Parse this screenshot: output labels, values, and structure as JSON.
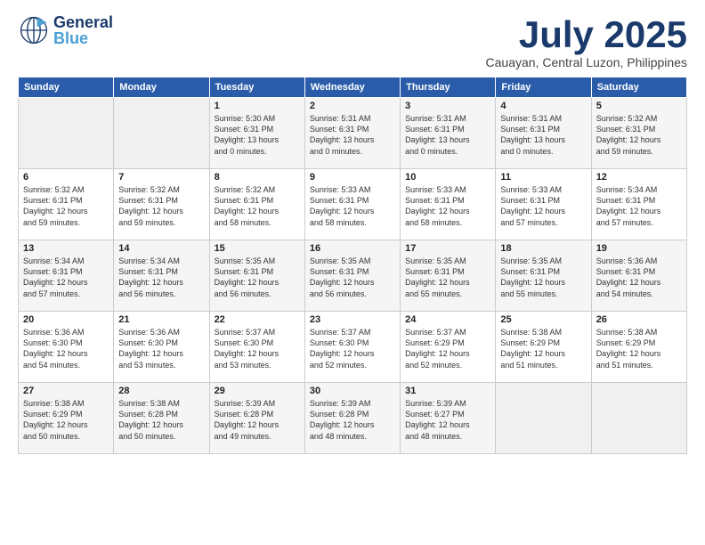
{
  "header": {
    "logo_general": "General",
    "logo_blue": "Blue",
    "main_title": "July 2025",
    "subtitle": "Cauayan, Central Luzon, Philippines"
  },
  "days_of_week": [
    "Sunday",
    "Monday",
    "Tuesday",
    "Wednesday",
    "Thursday",
    "Friday",
    "Saturday"
  ],
  "weeks": [
    [
      {
        "day": "",
        "info": ""
      },
      {
        "day": "",
        "info": ""
      },
      {
        "day": "1",
        "info": "Sunrise: 5:30 AM\nSunset: 6:31 PM\nDaylight: 13 hours\nand 0 minutes."
      },
      {
        "day": "2",
        "info": "Sunrise: 5:31 AM\nSunset: 6:31 PM\nDaylight: 13 hours\nand 0 minutes."
      },
      {
        "day": "3",
        "info": "Sunrise: 5:31 AM\nSunset: 6:31 PM\nDaylight: 13 hours\nand 0 minutes."
      },
      {
        "day": "4",
        "info": "Sunrise: 5:31 AM\nSunset: 6:31 PM\nDaylight: 13 hours\nand 0 minutes."
      },
      {
        "day": "5",
        "info": "Sunrise: 5:32 AM\nSunset: 6:31 PM\nDaylight: 12 hours\nand 59 minutes."
      }
    ],
    [
      {
        "day": "6",
        "info": "Sunrise: 5:32 AM\nSunset: 6:31 PM\nDaylight: 12 hours\nand 59 minutes."
      },
      {
        "day": "7",
        "info": "Sunrise: 5:32 AM\nSunset: 6:31 PM\nDaylight: 12 hours\nand 59 minutes."
      },
      {
        "day": "8",
        "info": "Sunrise: 5:32 AM\nSunset: 6:31 PM\nDaylight: 12 hours\nand 58 minutes."
      },
      {
        "day": "9",
        "info": "Sunrise: 5:33 AM\nSunset: 6:31 PM\nDaylight: 12 hours\nand 58 minutes."
      },
      {
        "day": "10",
        "info": "Sunrise: 5:33 AM\nSunset: 6:31 PM\nDaylight: 12 hours\nand 58 minutes."
      },
      {
        "day": "11",
        "info": "Sunrise: 5:33 AM\nSunset: 6:31 PM\nDaylight: 12 hours\nand 57 minutes."
      },
      {
        "day": "12",
        "info": "Sunrise: 5:34 AM\nSunset: 6:31 PM\nDaylight: 12 hours\nand 57 minutes."
      }
    ],
    [
      {
        "day": "13",
        "info": "Sunrise: 5:34 AM\nSunset: 6:31 PM\nDaylight: 12 hours\nand 57 minutes."
      },
      {
        "day": "14",
        "info": "Sunrise: 5:34 AM\nSunset: 6:31 PM\nDaylight: 12 hours\nand 56 minutes."
      },
      {
        "day": "15",
        "info": "Sunrise: 5:35 AM\nSunset: 6:31 PM\nDaylight: 12 hours\nand 56 minutes."
      },
      {
        "day": "16",
        "info": "Sunrise: 5:35 AM\nSunset: 6:31 PM\nDaylight: 12 hours\nand 56 minutes."
      },
      {
        "day": "17",
        "info": "Sunrise: 5:35 AM\nSunset: 6:31 PM\nDaylight: 12 hours\nand 55 minutes."
      },
      {
        "day": "18",
        "info": "Sunrise: 5:35 AM\nSunset: 6:31 PM\nDaylight: 12 hours\nand 55 minutes."
      },
      {
        "day": "19",
        "info": "Sunrise: 5:36 AM\nSunset: 6:31 PM\nDaylight: 12 hours\nand 54 minutes."
      }
    ],
    [
      {
        "day": "20",
        "info": "Sunrise: 5:36 AM\nSunset: 6:30 PM\nDaylight: 12 hours\nand 54 minutes."
      },
      {
        "day": "21",
        "info": "Sunrise: 5:36 AM\nSunset: 6:30 PM\nDaylight: 12 hours\nand 53 minutes."
      },
      {
        "day": "22",
        "info": "Sunrise: 5:37 AM\nSunset: 6:30 PM\nDaylight: 12 hours\nand 53 minutes."
      },
      {
        "day": "23",
        "info": "Sunrise: 5:37 AM\nSunset: 6:30 PM\nDaylight: 12 hours\nand 52 minutes."
      },
      {
        "day": "24",
        "info": "Sunrise: 5:37 AM\nSunset: 6:29 PM\nDaylight: 12 hours\nand 52 minutes."
      },
      {
        "day": "25",
        "info": "Sunrise: 5:38 AM\nSunset: 6:29 PM\nDaylight: 12 hours\nand 51 minutes."
      },
      {
        "day": "26",
        "info": "Sunrise: 5:38 AM\nSunset: 6:29 PM\nDaylight: 12 hours\nand 51 minutes."
      }
    ],
    [
      {
        "day": "27",
        "info": "Sunrise: 5:38 AM\nSunset: 6:29 PM\nDaylight: 12 hours\nand 50 minutes."
      },
      {
        "day": "28",
        "info": "Sunrise: 5:38 AM\nSunset: 6:28 PM\nDaylight: 12 hours\nand 50 minutes."
      },
      {
        "day": "29",
        "info": "Sunrise: 5:39 AM\nSunset: 6:28 PM\nDaylight: 12 hours\nand 49 minutes."
      },
      {
        "day": "30",
        "info": "Sunrise: 5:39 AM\nSunset: 6:28 PM\nDaylight: 12 hours\nand 48 minutes."
      },
      {
        "day": "31",
        "info": "Sunrise: 5:39 AM\nSunset: 6:27 PM\nDaylight: 12 hours\nand 48 minutes."
      },
      {
        "day": "",
        "info": ""
      },
      {
        "day": "",
        "info": ""
      }
    ]
  ]
}
